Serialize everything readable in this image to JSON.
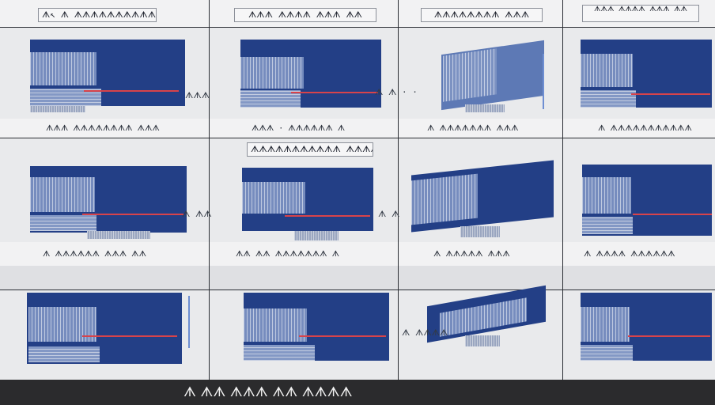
{
  "row1": {
    "titles": [
      "ᗑ↖ ᗑ ᗑᗑᗑᗑᗑᗑᗑᗑᗑᗑ",
      "ᗑᗑᗑ ᗑᗑᗑᗑ ᗑᗑᗑ ᗑᗑ",
      "ᗑᗑᗑᗑᗑᗑᗑᗑ ᗑᗑᗑ",
      "ᗑᗑᗑ ᗑᗑᗑᗑ ᗑᗑᗑ ᗑᗑ"
    ],
    "captions": [
      "ᗑᗑᗑ ᗑᗑᗑᗑᗑᗑᗑᗑ ᗑᗑᗑ",
      "ᗑᗑᗑ · ᗑᗑᗑᗑᗑᗑ ᗑ",
      "ᗑ ᗑᗑᗑᗑᗑᗑᗑ ᗑᗑᗑ",
      "ᗑ ᗑᗑᗑᗑᗑᗑᗑᗑᗑᗑᗑ"
    ],
    "side_marks": [
      "ᗑᗑᗑ",
      "ᗑ ᗑ · ·"
    ]
  },
  "row2": {
    "center_title": "ᗑᗑᗑᗑᗑᗑᗑᗑᗑᗑᗑ ᗑᗑᗑᗑ",
    "captions": [
      "ᗑ ᗑᗑᗑᗑᗑᗑ ᗑᗑᗑ ᗑᗑ",
      "ᗑᗑ ᗑᗑ ᗑᗑᗑᗑᗑᗑᗑ ᗑ",
      "ᗑ ᗑᗑᗑᗑᗑ ᗑᗑᗑ",
      "ᗑ ᗑᗑᗑᗑ ᗑᗑᗑᗑᗑᗑ"
    ],
    "side_marks": [
      "ᗑ ᗑᗑ",
      "ᗑ ᗑ"
    ]
  },
  "row3": {
    "side_marks": [
      "ᗑ ᗑᗑᗑᗑ"
    ]
  },
  "footer": {
    "text": "ᗑ ᗑᗑ ᗑᗑᗑ ᗑᗑ ᗑᗑᗑᗑ"
  },
  "colors": {
    "panel_blue": "#233f86",
    "accent_red": "#d8434a",
    "grid_line": "#2a2d33",
    "background": "#e9eaec",
    "footer_bg": "#2b2b2d"
  }
}
